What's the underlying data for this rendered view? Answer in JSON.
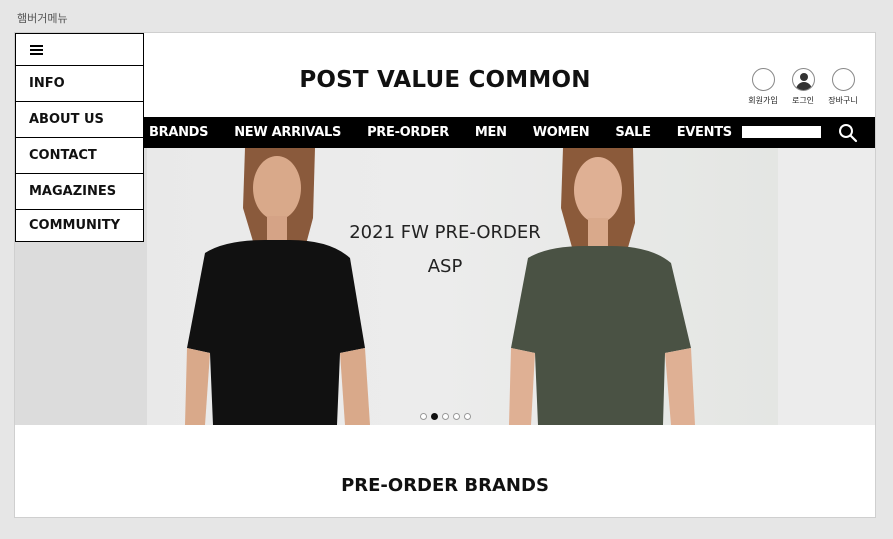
{
  "caption": "햄버거메뉴",
  "header": {
    "logo": "POST VALUE COMMON",
    "user_links": [
      {
        "label": "회원가입",
        "icon": "circle-icon"
      },
      {
        "label": "로그인",
        "icon": "user-icon"
      },
      {
        "label": "장바구니",
        "icon": "circle-icon"
      }
    ]
  },
  "nav": {
    "items": [
      "BRANDS",
      "NEW ARRIVALS",
      "PRE-ORDER",
      "MEN",
      "WOMEN",
      "SALE",
      "EVENTS"
    ],
    "search_placeholder": "",
    "search_icon": "search-icon"
  },
  "hero": {
    "line1": "2021 FW PRE-ORDER",
    "line2": "ASP",
    "slide_count": 5,
    "active_slide": 2
  },
  "section": {
    "title": "PRE-ORDER BRANDS"
  },
  "side_menu": {
    "toggle_icon": "hamburger-icon",
    "items": [
      "INFO",
      "ABOUT US",
      "CONTACT",
      "MAGAZINES",
      "COMMUNITY"
    ]
  },
  "colors": {
    "nav_bg": "#000000",
    "shirt_left": "#111111",
    "shirt_right": "#4a5244"
  }
}
